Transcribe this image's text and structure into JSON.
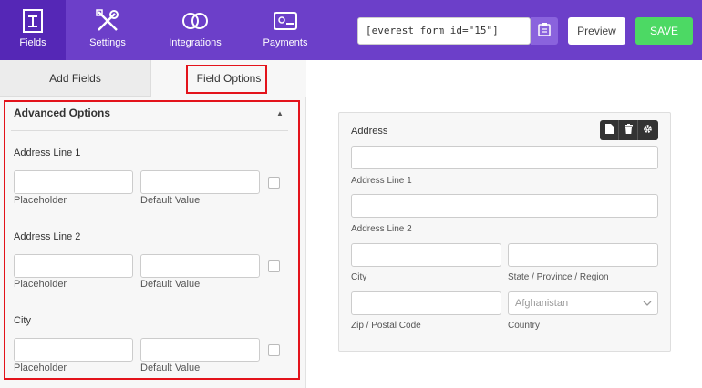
{
  "nav": {
    "fields": "Fields",
    "settings": "Settings",
    "integrations": "Integrations",
    "payments": "Payments"
  },
  "shortcode": "[everest_form id=\"15\"]",
  "buttons": {
    "preview": "Preview",
    "save": "SAVE"
  },
  "tabs": {
    "add_fields": "Add Fields",
    "field_options": "Field Options"
  },
  "advanced": {
    "title": "Advanced Options",
    "sections": [
      {
        "label": "Address Line 1",
        "placeholder_label": "Placeholder",
        "default_label": "Default Value"
      },
      {
        "label": "Address Line 2",
        "placeholder_label": "Placeholder",
        "default_label": "Default Value"
      },
      {
        "label": "City",
        "placeholder_label": "Placeholder",
        "default_label": "Default Value"
      }
    ]
  },
  "preview": {
    "title": "Address",
    "labels": {
      "line1": "Address Line 1",
      "line2": "Address Line 2",
      "city": "City",
      "state": "State / Province / Region",
      "zip": "Zip / Postal Code",
      "country": "Country"
    },
    "country_value": "Afghanistan"
  },
  "colors": {
    "topbar": "#6c3fc9",
    "active_nav": "#5527b6",
    "save": "#4cd964",
    "highlight": "#e3131b"
  },
  "icons": [
    "fields-icon",
    "settings-icon",
    "integrations-icon",
    "payments-icon",
    "copy-icon",
    "file-icon",
    "trash-icon",
    "gear-icon",
    "chevron-down-icon",
    "caret-up-icon"
  ]
}
